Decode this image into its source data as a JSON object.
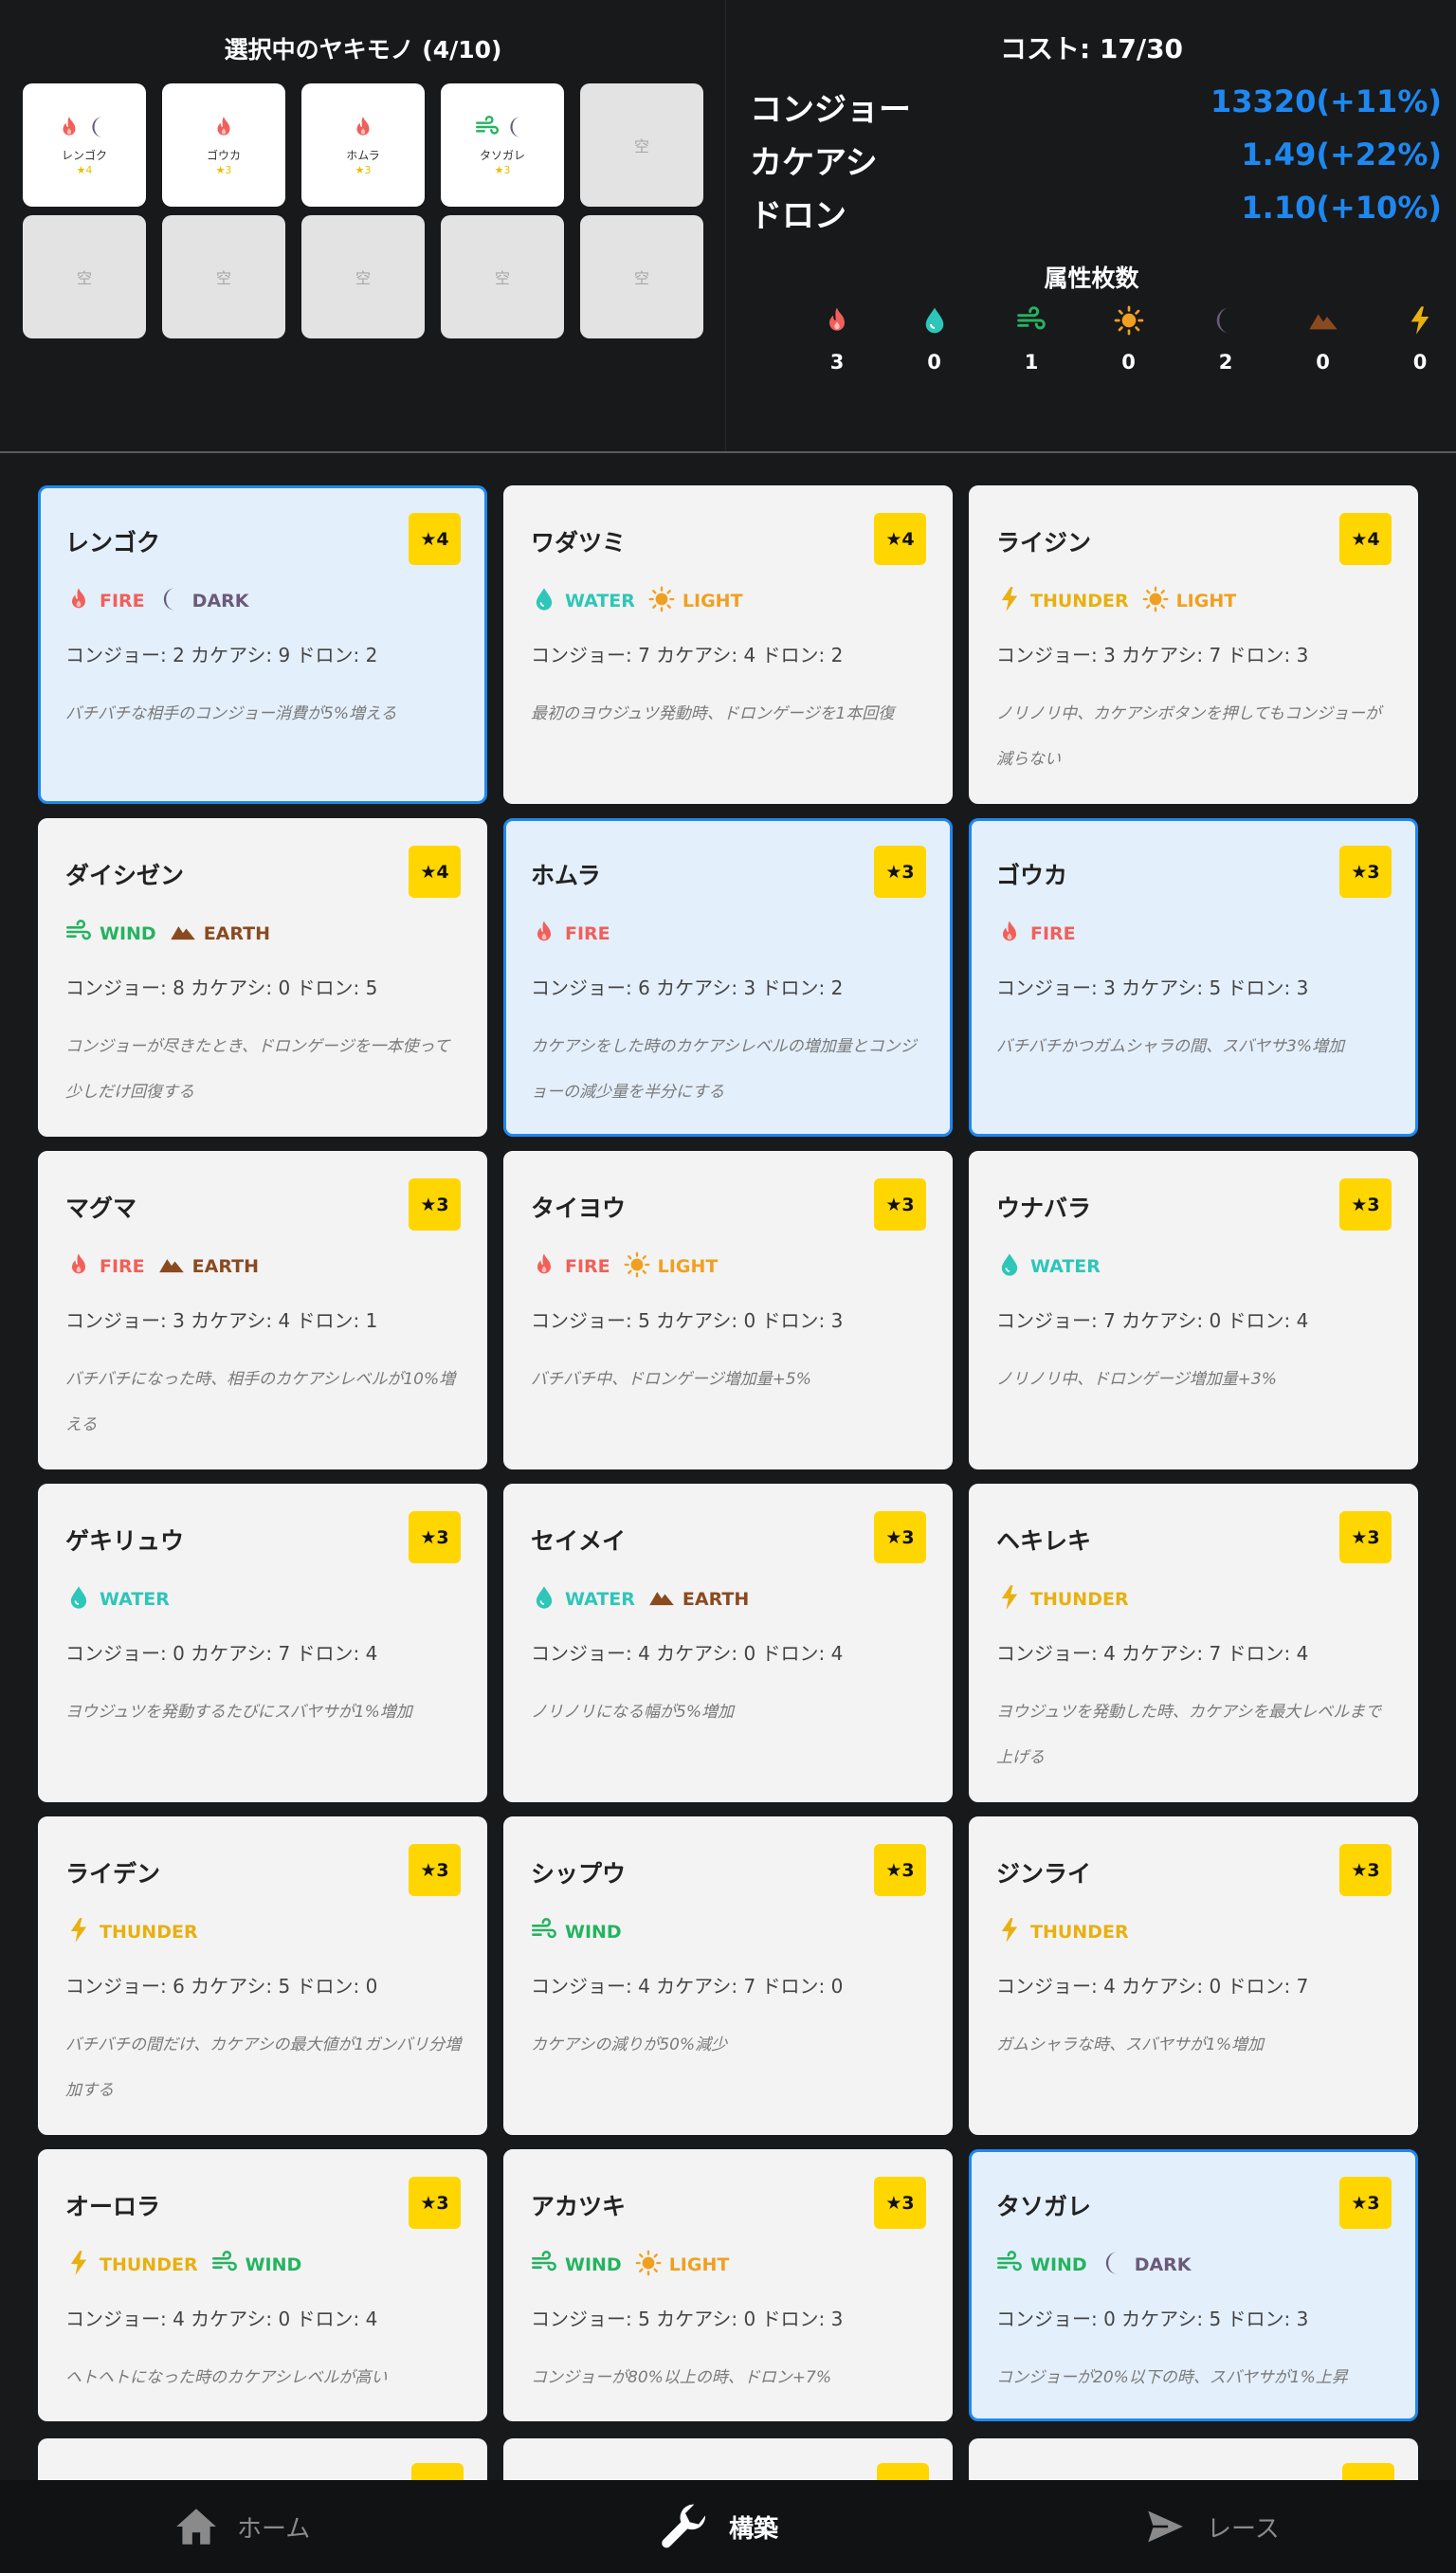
{
  "selected": {
    "title": "選択中のヤキモノ (4/10)",
    "empty_label": "空",
    "slots": [
      {
        "name": "レンゴク",
        "rarity": "★4",
        "icons": [
          "fire-icon",
          "moon-icon"
        ]
      },
      {
        "name": "ゴウカ",
        "rarity": "★3",
        "icons": [
          "fire-icon"
        ]
      },
      {
        "name": "ホムラ",
        "rarity": "★3",
        "icons": [
          "fire-icon"
        ]
      },
      {
        "name": "タソガレ",
        "rarity": "★3",
        "icons": [
          "wind-icon",
          "moon-icon"
        ]
      }
    ]
  },
  "summary": {
    "cost": "コスト: 17/30",
    "stats": [
      {
        "name": "コンジョー",
        "value": "13320(+11%)"
      },
      {
        "name": "カケアシ",
        "value": "1.49(+22%)"
      },
      {
        "name": "ドロン",
        "value": "1.10(+10%)"
      }
    ],
    "attr_title": "属性枚数",
    "attributes": [
      {
        "icon": "fire-icon",
        "count": "3"
      },
      {
        "icon": "water-icon",
        "count": "0"
      },
      {
        "icon": "wind-icon",
        "count": "1"
      },
      {
        "icon": "sun-icon",
        "count": "0"
      },
      {
        "icon": "moon-icon",
        "count": "2"
      },
      {
        "icon": "mountain-icon",
        "count": "0"
      },
      {
        "icon": "thunder-icon",
        "count": "0"
      }
    ]
  },
  "colors": {
    "accent": "#1e88f0",
    "rarity_badge": "#ffd600",
    "fire": "#f0605a",
    "water": "#2ec6b8",
    "wind": "#25b360",
    "light": "#f0a020",
    "dark": "#6a5a7a",
    "earth": "#8a4a20",
    "thunder": "#e8b010"
  },
  "cards": [
    {
      "name": "レンゴク",
      "rarity": "★4",
      "selected": true,
      "types": [
        {
          "label": "FIRE",
          "icon": "fire-icon"
        },
        {
          "label": "DARK",
          "icon": "moon-icon"
        }
      ],
      "stats": "コンジョー: 2 カケアシ: 9 ドロン: 2",
      "desc": "バチバチな相手のコンジョー消費が5%増える"
    },
    {
      "name": "ワダツミ",
      "rarity": "★4",
      "selected": false,
      "types": [
        {
          "label": "WATER",
          "icon": "water-icon"
        },
        {
          "label": "LIGHT",
          "icon": "sun-icon"
        }
      ],
      "stats": "コンジョー: 7 カケアシ: 4 ドロン: 2",
      "desc": "最初のヨウジュツ発動時、ドロンゲージを1本回復"
    },
    {
      "name": "ライジン",
      "rarity": "★4",
      "selected": false,
      "types": [
        {
          "label": "THUNDER",
          "icon": "thunder-icon"
        },
        {
          "label": "LIGHT",
          "icon": "sun-icon"
        }
      ],
      "stats": "コンジョー: 3 カケアシ: 7 ドロン: 3",
      "desc": "ノリノリ中、カケアシボタンを押してもコンジョーが減らない"
    },
    {
      "name": "ダイシゼン",
      "rarity": "★4",
      "selected": false,
      "types": [
        {
          "label": "WIND",
          "icon": "wind-icon"
        },
        {
          "label": "EARTH",
          "icon": "mountain-icon"
        }
      ],
      "stats": "コンジョー: 8 カケアシ: 0 ドロン: 5",
      "desc": "コンジョーが尽きたとき、ドロンゲージを一本使って少しだけ回復する"
    },
    {
      "name": "ホムラ",
      "rarity": "★3",
      "selected": true,
      "types": [
        {
          "label": "FIRE",
          "icon": "fire-icon"
        }
      ],
      "stats": "コンジョー: 6 カケアシ: 3 ドロン: 2",
      "desc": "カケアシをした時のカケアシレベルの増加量とコンジョーの減少量を半分にする"
    },
    {
      "name": "ゴウカ",
      "rarity": "★3",
      "selected": true,
      "types": [
        {
          "label": "FIRE",
          "icon": "fire-icon"
        }
      ],
      "stats": "コンジョー: 3 カケアシ: 5 ドロン: 3",
      "desc": "バチバチかつガムシャラの間、スバヤサ3%増加"
    },
    {
      "name": "マグマ",
      "rarity": "★3",
      "selected": false,
      "types": [
        {
          "label": "FIRE",
          "icon": "fire-icon"
        },
        {
          "label": "EARTH",
          "icon": "mountain-icon"
        }
      ],
      "stats": "コンジョー: 3 カケアシ: 4 ドロン: 1",
      "desc": "バチバチになった時、相手のカケアシレベルが10%増える"
    },
    {
      "name": "タイヨウ",
      "rarity": "★3",
      "selected": false,
      "types": [
        {
          "label": "FIRE",
          "icon": "fire-icon"
        },
        {
          "label": "LIGHT",
          "icon": "sun-icon"
        }
      ],
      "stats": "コンジョー: 5 カケアシ: 0 ドロン: 3",
      "desc": "バチバチ中、ドロンゲージ増加量+5%"
    },
    {
      "name": "ウナバラ",
      "rarity": "★3",
      "selected": false,
      "types": [
        {
          "label": "WATER",
          "icon": "water-icon"
        }
      ],
      "stats": "コンジョー: 7 カケアシ: 0 ドロン: 4",
      "desc": "ノリノリ中、ドロンゲージ増加量+3%"
    },
    {
      "name": "ゲキリュウ",
      "rarity": "★3",
      "selected": false,
      "types": [
        {
          "label": "WATER",
          "icon": "water-icon"
        }
      ],
      "stats": "コンジョー: 0 カケアシ: 7 ドロン: 4",
      "desc": "ヨウジュツを発動するたびにスバヤサが1%増加"
    },
    {
      "name": "セイメイ",
      "rarity": "★3",
      "selected": false,
      "types": [
        {
          "label": "WATER",
          "icon": "water-icon"
        },
        {
          "label": "EARTH",
          "icon": "mountain-icon"
        }
      ],
      "stats": "コンジョー: 4 カケアシ: 0 ドロン: 4",
      "desc": "ノリノリになる幅が5%増加"
    },
    {
      "name": "ヘキレキ",
      "rarity": "★3",
      "selected": false,
      "types": [
        {
          "label": "THUNDER",
          "icon": "thunder-icon"
        }
      ],
      "stats": "コンジョー: 4 カケアシ: 7 ドロン: 4",
      "desc": "ヨウジュツを発動した時、カケアシを最大レベルまで上げる"
    },
    {
      "name": "ライデン",
      "rarity": "★3",
      "selected": false,
      "types": [
        {
          "label": "THUNDER",
          "icon": "thunder-icon"
        }
      ],
      "stats": "コンジョー: 6 カケアシ: 5 ドロン: 0",
      "desc": "バチバチの間だけ、カケアシの最大値が1ガンバリ分増加する"
    },
    {
      "name": "シップウ",
      "rarity": "★3",
      "selected": false,
      "types": [
        {
          "label": "WIND",
          "icon": "wind-icon"
        }
      ],
      "stats": "コンジョー: 4 カケアシ: 7 ドロン: 0",
      "desc": "カケアシの減りが50%減少"
    },
    {
      "name": "ジンライ",
      "rarity": "★3",
      "selected": false,
      "types": [
        {
          "label": "THUNDER",
          "icon": "thunder-icon"
        }
      ],
      "stats": "コンジョー: 4 カケアシ: 0 ドロン: 7",
      "desc": "ガムシャラな時、スバヤサが1%増加"
    },
    {
      "name": "オーロラ",
      "rarity": "★3",
      "selected": false,
      "types": [
        {
          "label": "THUNDER",
          "icon": "thunder-icon"
        },
        {
          "label": "WIND",
          "icon": "wind-icon"
        }
      ],
      "stats": "コンジョー: 4 カケアシ: 0 ドロン: 4",
      "desc": "ヘトヘトになった時のカケアシレベルが高い"
    },
    {
      "name": "アカツキ",
      "rarity": "★3",
      "selected": false,
      "types": [
        {
          "label": "WIND",
          "icon": "wind-icon"
        },
        {
          "label": "LIGHT",
          "icon": "sun-icon"
        }
      ],
      "stats": "コンジョー: 5 カケアシ: 0 ドロン: 3",
      "desc": "コンジョーが80%以上の時、ドロン+7%"
    },
    {
      "name": "タソガレ",
      "rarity": "★3",
      "selected": true,
      "types": [
        {
          "label": "WIND",
          "icon": "wind-icon"
        },
        {
          "label": "DARK",
          "icon": "moon-icon"
        }
      ],
      "stats": "コンジョー: 0 カケアシ: 5 ドロン: 3",
      "desc": "コンジョーが20%以下の時、スバヤサが1%上昇"
    }
  ],
  "nav": {
    "items": [
      {
        "label": "ホーム",
        "icon": "home-icon",
        "active": false
      },
      {
        "label": "構築",
        "icon": "wrench-icon",
        "active": true
      },
      {
        "label": "レース",
        "icon": "send-icon",
        "active": false
      }
    ]
  }
}
